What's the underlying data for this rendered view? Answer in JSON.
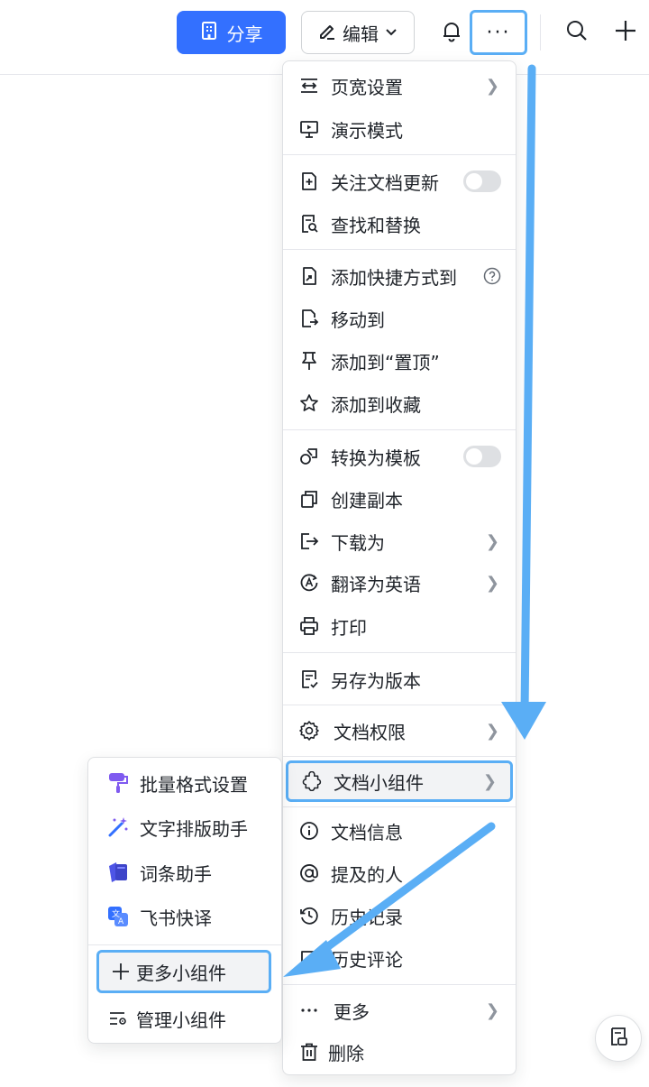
{
  "toolbar": {
    "share_label": "分享",
    "edit_label": "编辑",
    "more_label": "···"
  },
  "menu": {
    "items": [
      {
        "label": "页宽设置",
        "icon": "page-width-icon",
        "has_submenu": true
      },
      {
        "label": "演示模式",
        "icon": "presentation-icon"
      },
      {
        "label": "关注文档更新",
        "icon": "follow-icon",
        "toggle": false
      },
      {
        "label": "查找和替换",
        "icon": "find-replace-icon"
      },
      {
        "label": "添加快捷方式到",
        "icon": "shortcut-icon",
        "help": true
      },
      {
        "label": "移动到",
        "icon": "move-icon"
      },
      {
        "label": "添加到“置顶”",
        "icon": "pin-icon"
      },
      {
        "label": "添加到收藏",
        "icon": "star-icon"
      },
      {
        "label": "转换为模板",
        "icon": "template-icon",
        "toggle": false
      },
      {
        "label": "创建副本",
        "icon": "copy-icon"
      },
      {
        "label": "下载为",
        "icon": "download-icon",
        "has_submenu": true
      },
      {
        "label": "翻译为英语",
        "icon": "translate-icon",
        "has_submenu": true
      },
      {
        "label": "打印",
        "icon": "print-icon"
      },
      {
        "label": "另存为版本",
        "icon": "save-version-icon"
      },
      {
        "label": "文档权限",
        "icon": "gear-icon",
        "has_submenu": true
      },
      {
        "label": "文档小组件",
        "icon": "widget-icon",
        "has_submenu": true,
        "highlighted": true
      },
      {
        "label": "文档信息",
        "icon": "info-icon"
      },
      {
        "label": "提及的人",
        "icon": "at-icon"
      },
      {
        "label": "历史记录",
        "icon": "history-icon"
      },
      {
        "label": "历史评论",
        "icon": "comment-history-icon"
      },
      {
        "label": "更多",
        "icon": "ellipsis-icon",
        "has_submenu": true
      },
      {
        "label": "删除",
        "icon": "trash-icon"
      }
    ]
  },
  "submenu": {
    "items": [
      {
        "label": "批量格式设置",
        "icon": "format-brush-icon",
        "color": "#7f5af0"
      },
      {
        "label": "文字排版助手",
        "icon": "magic-wand-icon",
        "color": "#3370ff"
      },
      {
        "label": "词条助手",
        "icon": "cards-icon",
        "color": "#4e55e6"
      },
      {
        "label": "飞书快译",
        "icon": "translate-app-icon",
        "color": "#3370ff"
      },
      {
        "label": "更多小组件",
        "icon": "plus-icon",
        "highlighted": true
      },
      {
        "label": "管理小组件",
        "icon": "manage-widgets-icon"
      }
    ]
  },
  "colors": {
    "accent": "#3370ff",
    "annotation": "#5aaef5"
  }
}
